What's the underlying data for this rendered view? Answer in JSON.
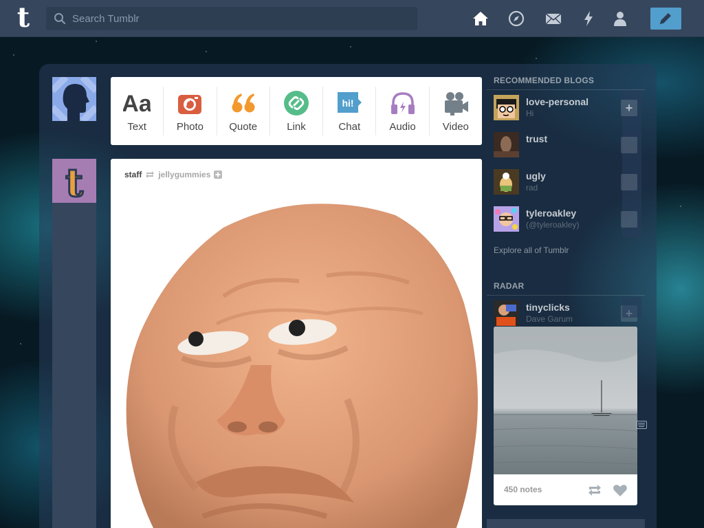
{
  "topbar": {
    "logo": "t",
    "search_placeholder": "Search Tumblr",
    "nav_icons": [
      "home-icon",
      "compass-icon",
      "mail-icon",
      "lightning-icon",
      "person-icon"
    ],
    "compose_icon": "pencil-icon"
  },
  "post_types": [
    {
      "label": "Text",
      "glyph": "Aa",
      "color": "#444444"
    },
    {
      "label": "Photo",
      "color": "#d95e40"
    },
    {
      "label": "Quote",
      "glyph": "❝",
      "color": "#f2992e"
    },
    {
      "label": "Link",
      "color": "#56bc8a"
    },
    {
      "label": "Chat",
      "glyph": "hi!",
      "color": "#529ecc"
    },
    {
      "label": "Audio",
      "color": "#a77dc2"
    },
    {
      "label": "Video",
      "color": "#748089"
    }
  ],
  "post": {
    "author": "staff",
    "reblogged_from": "jellygummies"
  },
  "sidebar": {
    "recommended_title": "RECOMMENDED BLOGS",
    "blogs": [
      {
        "name": "love-personal",
        "sub": "Hi"
      },
      {
        "name": "trust",
        "sub": ""
      },
      {
        "name": "ugly",
        "sub": "rad"
      },
      {
        "name": "tyleroakley",
        "sub": "(@tyleroakley)"
      }
    ],
    "explore": "Explore all of Tumblr",
    "radar_title": "RADAR",
    "radar_blog": {
      "name": "tinyclicks",
      "sub": "Dave Garum"
    },
    "radar_notes": "450 notes"
  },
  "colors": {
    "topbar": "#36465d",
    "compose": "#529ecc"
  }
}
